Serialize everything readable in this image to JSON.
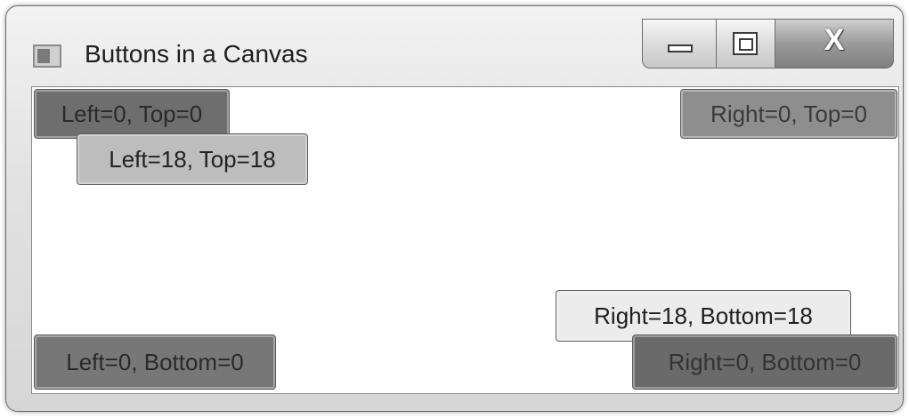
{
  "window": {
    "title": "Buttons in a Canvas",
    "icon": "app-window-icon",
    "caption": {
      "minimize_icon": "minimize-icon",
      "maximize_icon": "maximize-icon",
      "close_glyph": "X"
    }
  },
  "canvas": {
    "buttons": [
      {
        "label": "Left=0, Top=0"
      },
      {
        "label": "Left=18, Top=18"
      },
      {
        "label": "Right=0, Top=0"
      },
      {
        "label": "Right=18, Bottom=18"
      },
      {
        "label": "Left=0, Bottom=0"
      },
      {
        "label": "Right=0, Bottom=0"
      }
    ]
  }
}
